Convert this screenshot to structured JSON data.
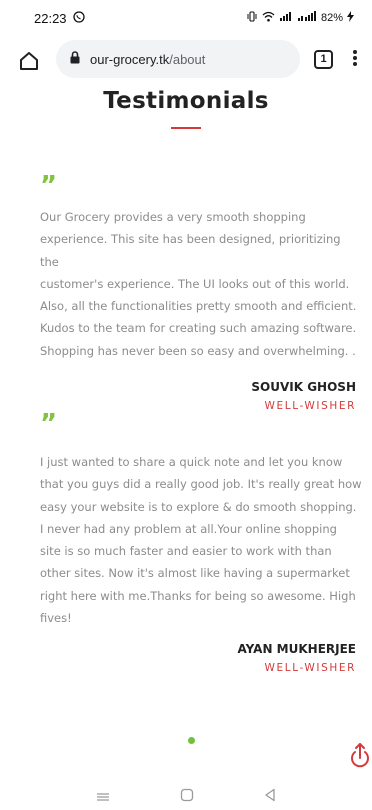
{
  "status_bar": {
    "time": "22:23",
    "battery": "82%"
  },
  "browser": {
    "url_domain": "our-grocery.tk",
    "url_path": "/about",
    "tab_count": "1"
  },
  "page": {
    "title": "Testimonials"
  },
  "testimonials": [
    {
      "text_lines": [
        "Our Grocery provides a very smooth shopping",
        "experience. This site has been designed, prioritizing the",
        "customer's experience. The UI looks out of this world.",
        "Also, all the functionalities pretty smooth and efficient.",
        "Kudos to the team for creating such amazing software.",
        "Shopping has never been so easy and overwhelming. ."
      ],
      "author": "SOUVIK GHOSH",
      "role": "WELL-WISHER"
    },
    {
      "text_lines": [
        "I just wanted to share a quick note and let you know",
        "that you guys did a really good job. It's really great how",
        "easy your website is to explore & do smooth shopping.",
        "I never had any problem at all.Your online shopping",
        "site is so much faster and easier to work with than",
        "other sites. Now it's almost like having a supermarket",
        "right here with me.Thanks for being so awesome. High",
        "fives!"
      ],
      "author": "AYAN MUKHERJEE",
      "role": "WELL-WISHER"
    }
  ],
  "colors": {
    "accent_red": "#d33b3b",
    "quote_green": "#82c341",
    "dot_green": "#6cc43a"
  }
}
